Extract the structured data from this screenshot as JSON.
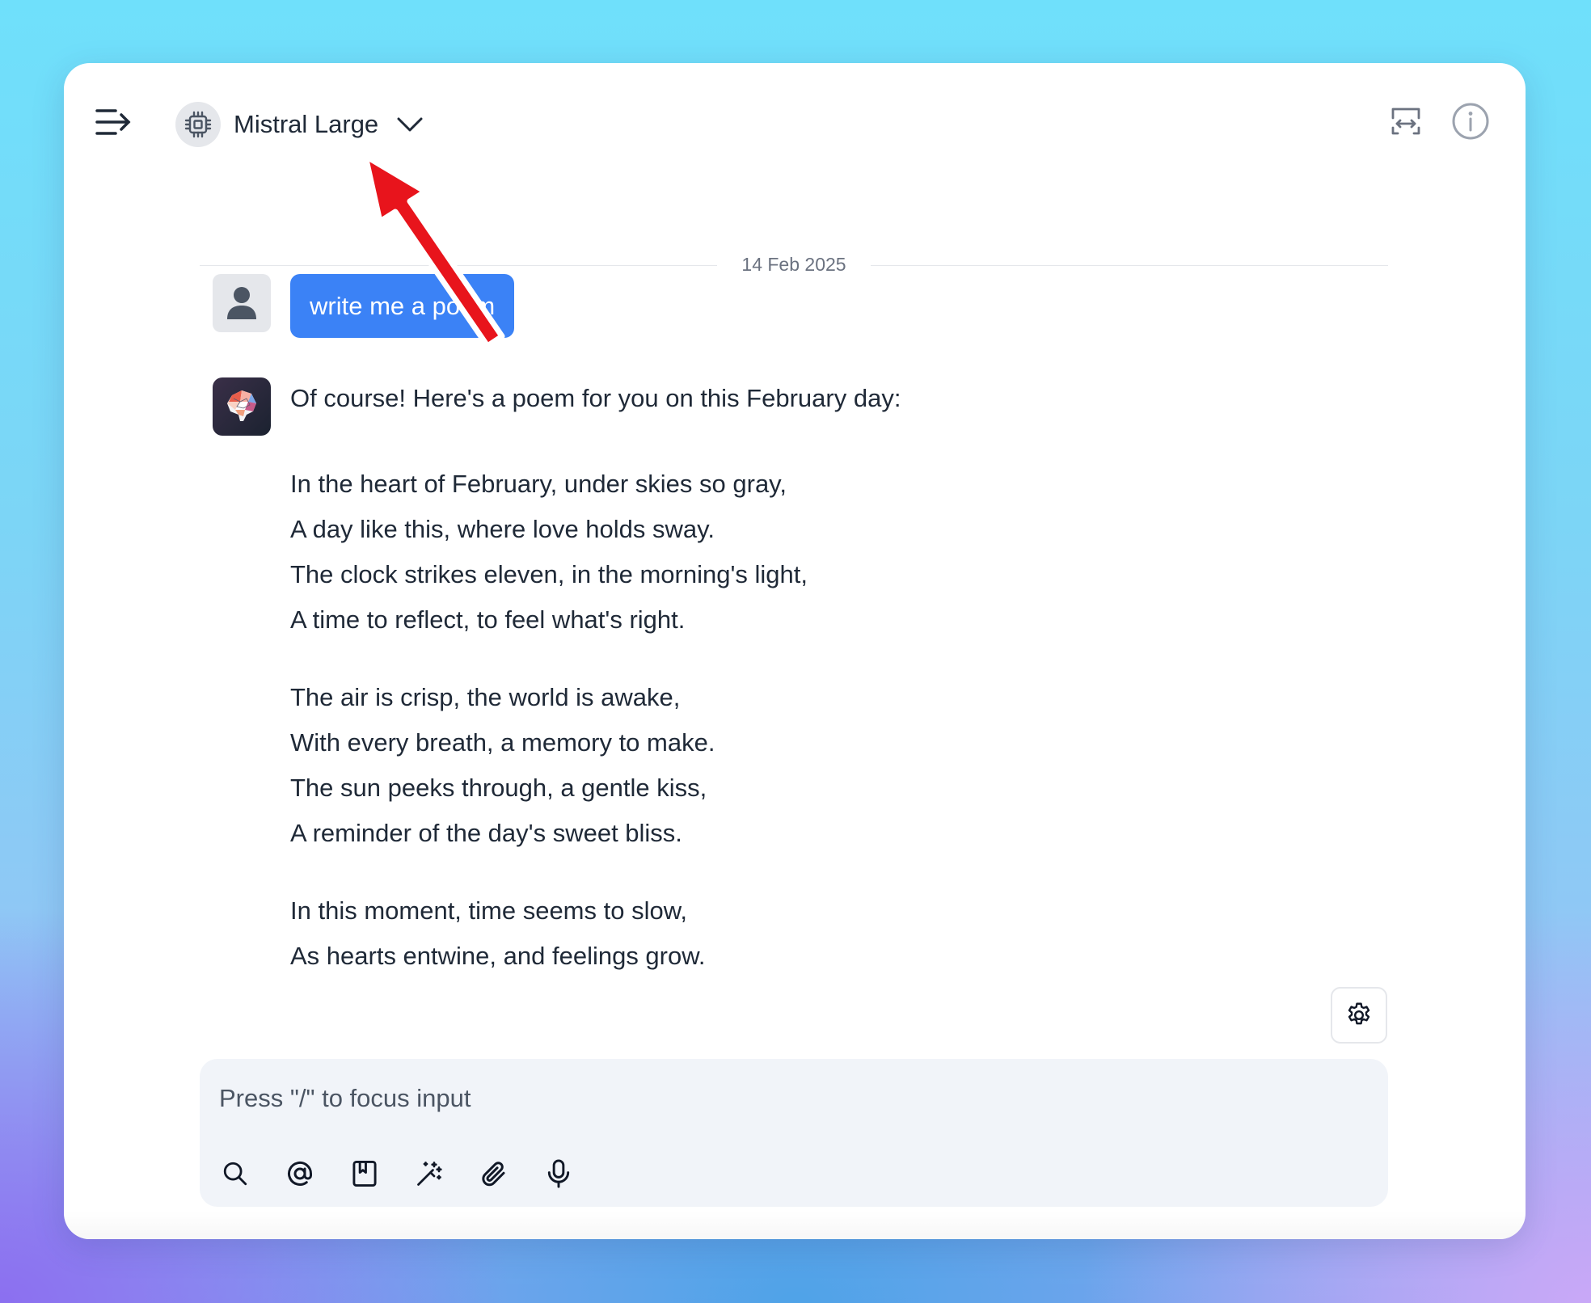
{
  "header": {
    "model_name": "Mistral Large",
    "icons": {
      "menu": "menu-arrow-icon",
      "model": "chip-icon",
      "dropdown": "chevron-down-icon",
      "layout": "expand-horizontal-icon",
      "info": "info-icon"
    }
  },
  "chat": {
    "date_divider": "14 Feb 2025",
    "user_message": "write me a poem",
    "assistant_intro": "Of course! Here's a poem for you on this February day:",
    "poem_stanzas": [
      [
        "In the heart of February, under skies so gray,",
        "A day like this, where love holds sway.",
        "The clock strikes eleven, in the morning's light,",
        "A time to reflect, to feel what's right."
      ],
      [
        "The air is crisp, the world is awake,",
        "With every breath, a memory to make.",
        "The sun peeks through, a gentle kiss,",
        "A reminder of the day's sweet bliss."
      ],
      [
        "In this moment, time seems to slow,",
        "As hearts entwine, and feelings grow."
      ]
    ]
  },
  "composer": {
    "placeholder": "Press \"/\" to focus input",
    "tools": [
      "search-icon",
      "at-mention-icon",
      "bookmark-icon",
      "magic-wand-icon",
      "paperclip-icon",
      "microphone-icon"
    ]
  },
  "colors": {
    "accent": "#3b82f6",
    "annotation_arrow": "#e8141c"
  }
}
